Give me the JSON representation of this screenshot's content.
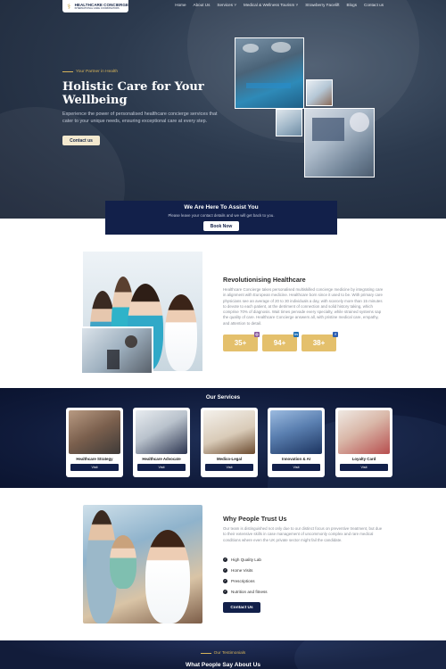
{
  "nav": {
    "logo_name": "HEALTHCARE CONCIERGE",
    "logo_sub": "INTERNATIONAL CARE COORDINATORS",
    "links": [
      "Home",
      "About Us",
      "Services ˅",
      "Medical & Wellness Tourism ˅",
      "Strawberry Facelift",
      "Blogs",
      "Contact us"
    ]
  },
  "hero": {
    "tagline": "Your Partner in Health",
    "title": "Holistic Care for Your Wellbeing",
    "description": "Experience the power of personalised healthcare concierge services that cater to your unique needs, ensuring exceptional care at every step.",
    "button": "Contact us"
  },
  "assist": {
    "title": "We Are Here To Assist You",
    "subtitle": "Please leave your contact details and we will get back to you.",
    "button": "Book Now"
  },
  "revolution": {
    "title": "Revolutionising Healthcare",
    "text": "Healthcare Concierge takes personalised multiskilled concierge medicine by integrating care in alignment with European medicine. Healthcare born since it used to be. With primary care physicians see an average of 20 to 30 individuals a day, with scarcely more than 15 minutes to devote to each patient, at the detriment of connection and solid history taking, which comprise 70% of diagnosis. Wait times pervade every specialty, while strained systems sap the quality of care. Healthcare Concierge answers all, with pristine medical care, empathy, and attention to detail.",
    "stats": [
      {
        "value": "35+",
        "icon": "instagram-icon",
        "color": "#8a5a9e"
      },
      {
        "value": "94+",
        "icon": "linkedin-icon",
        "color": "#1f6fb5"
      },
      {
        "value": "38+",
        "icon": "facebook-icon",
        "color": "#2d5fb3"
      }
    ]
  },
  "services": {
    "title": "Our Services",
    "button": "Visit",
    "items": [
      {
        "name": "Healthcare Strategy",
        "c1": "#9a7b63",
        "c2": "#3e3a38"
      },
      {
        "name": "Healthcare Advocate",
        "c1": "#d9dfe5",
        "c2": "#2c3550"
      },
      {
        "name": "Medico-Legal",
        "c1": "#f1eee8",
        "c2": "#6b4a2e"
      },
      {
        "name": "Innovation & AI",
        "c1": "#7ea0c8",
        "c2": "#1c3460"
      },
      {
        "name": "Loyalty Card",
        "c1": "#e8e2dc",
        "c2": "#b74e4e"
      }
    ]
  },
  "trust": {
    "title": "Why People Trust Us",
    "text": "Our team is distinguished not only due to our distinct focus on preventive treatment, but due to their extensive skills in case management of uncommonly complex and rare medical conditions where even the UK private sector might fail the candidate.",
    "items": [
      "High Quality Lab",
      "Home Visits",
      "Prescriptions",
      "Nutrition and fitness"
    ],
    "button": "Contact Us"
  },
  "testimonials": {
    "tag": "Our Testimonials",
    "title": "What People Say About Us"
  }
}
